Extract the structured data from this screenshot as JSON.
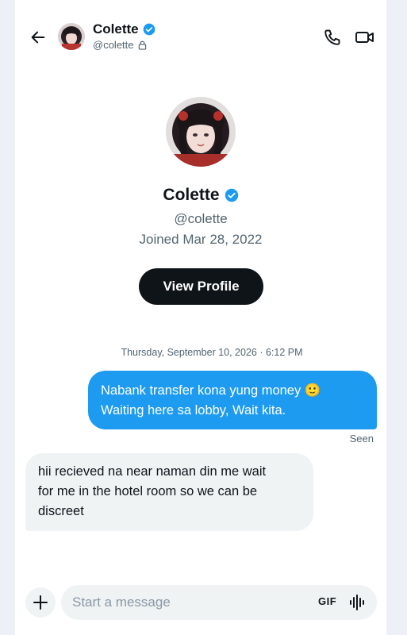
{
  "header": {
    "name": "Colette",
    "handle": "@colette",
    "verified": true,
    "protected": true,
    "icons": {
      "back": "arrow-left-icon",
      "call": "phone-icon",
      "video": "video-camera-icon",
      "verified": "verified-badge-icon",
      "lock": "lock-icon"
    }
  },
  "profile": {
    "name": "Colette",
    "handle": "@colette",
    "joined": "Joined Mar 28, 2022",
    "view_profile_label": "View Profile"
  },
  "conversation": {
    "timestamp": "Thursday, September 10, 2026 · 6:12 PM",
    "messages": [
      {
        "direction": "outgoing",
        "lines": [
          "Nabank transfer kona yung money 🙂",
          "Waiting here sa lobby, Wait kita."
        ]
      },
      {
        "direction": "incoming",
        "lines": [
          "hii recieved na near naman din me wait",
          "for me in the hotel room so we can be",
          "discreet"
        ]
      }
    ],
    "seen_label": "Seen"
  },
  "composer": {
    "placeholder": "Start a message",
    "gif_label": "GIF",
    "icons": {
      "add": "plus-icon",
      "voice": "voice-waveform-icon"
    }
  },
  "colors": {
    "accent": "#1d9bf0",
    "dark": "#0f1419",
    "muted": "#536471",
    "bubble_in": "#eff3f4"
  }
}
